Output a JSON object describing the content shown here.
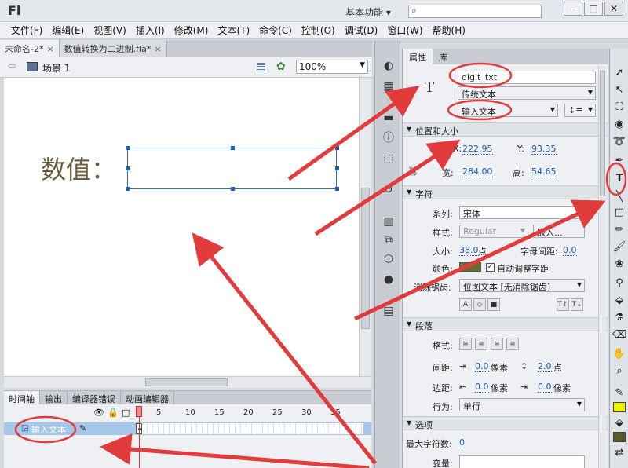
{
  "app": {
    "logo": "Fl",
    "workspace": "基本功能 ▾"
  },
  "menu": [
    "文件(F)",
    "编辑(E)",
    "视图(V)",
    "插入(I)",
    "修改(M)",
    "文本(T)",
    "命令(C)",
    "控制(O)",
    "调试(D)",
    "窗口(W)",
    "帮助(H)"
  ],
  "doc_tabs": [
    {
      "label": "未命名-2*",
      "close": "×"
    },
    {
      "label": "数值转换为二进制.fla*",
      "close": "×"
    }
  ],
  "edit_bar": {
    "scene": "场景 1",
    "zoom": "100%"
  },
  "stage": {
    "label_text": "数值："
  },
  "timeline": {
    "tabs": [
      "时间轴",
      "输出",
      "编译器错误",
      "动画编辑器"
    ],
    "ruler": [
      "1",
      "5",
      "10",
      "15",
      "20",
      "25",
      "30",
      "35"
    ],
    "layer_name": "输入文本"
  },
  "properties": {
    "tabs": [
      "属性",
      "库"
    ],
    "instance_name": "digit_txt",
    "text_engine": "传统文本",
    "text_type": "输入文本",
    "sections": {
      "position_size": "位置和大小",
      "character": "字符",
      "paragraph": "段落",
      "options": "选项"
    },
    "position": {
      "x_label": "X:",
      "x": "222.95",
      "y_label": "Y:",
      "y": "93.35"
    },
    "size": {
      "w_label": "宽:",
      "w": "284.00",
      "h_label": "高:",
      "h": "54.65"
    },
    "character": {
      "family_label": "系列:",
      "family": "宋体",
      "style_label": "样式:",
      "style": "Regular",
      "embed": "嵌入...",
      "size_label": "大小:",
      "size": "38.0",
      "size_unit": "点",
      "spacing_label": "字母间距:",
      "spacing": "0.0",
      "color_label": "颜色:",
      "color": "#6b6b2c",
      "auto_kern": "自动调整字距",
      "aa_label": "消除锯齿:",
      "aa": "位图文本 [无消除锯齿]"
    },
    "paragraph": {
      "format_label": "格式:",
      "spacing_label": "间距:",
      "indent": "0.0",
      "indent_unit": "像素",
      "line": "2.0",
      "line_unit": "点",
      "margin_label": "边距:",
      "left": "0.0",
      "left_unit": "像素",
      "right": "0.0",
      "right_unit": "像素",
      "behavior_label": "行为:",
      "behavior": "单行"
    },
    "options": {
      "max_chars_label": "最大字符数:",
      "max_chars": "0",
      "var_label": "变量:"
    }
  },
  "colors": {
    "annotation": "#e23b3b",
    "accent": "#1f5fb4",
    "fill_color": "#f3f300",
    "stroke_color": "#5b5a2c"
  }
}
